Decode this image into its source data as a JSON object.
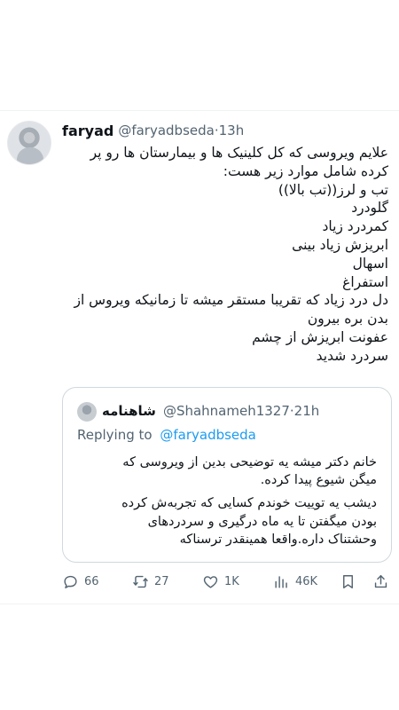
{
  "tweet": {
    "author": {
      "name": "faryad",
      "handle": "@faryadbseda",
      "time": "·13h"
    },
    "lines": [
      "علایم ویروسی که کل کلینیک ها و بیمارستان ها رو پر",
      "کرده شامل موارد زیر هست:",
      "تب و لرز((تب بالا))",
      "گلودرد",
      "کمردرد زیاد",
      "ابریزش زیاد بینی",
      "اسهال",
      "استفراغ",
      "دل درد زیاد که تقریبا مستقر میشه تا زمانیکه ویروس از",
      "بدن بره بیرون",
      "عفونت ابریزش از چشم",
      "سردرد شدید"
    ]
  },
  "quote": {
    "name": "شاهنامه",
    "handle": "@Shahnameh1327",
    "time": "·21h",
    "replying_prefix": "Replying to",
    "replying_handle": "@faryadbseda",
    "lines": [
      "خانم دکتر میشه یه توضیحی بدین از ویروسی که",
      "میگن شیوع پیدا کرده.",
      "دیشب یه توییت خوندم کسایی که تجربه‌ش کرده",
      "بودن میگفتن تا یه ماه درگیری و سردردهای",
      "وحشتناک داره.واقعا همینقدر ترسناکه"
    ]
  },
  "actions": {
    "replies": "66",
    "retweets": "27",
    "likes": "1K",
    "views": "46K",
    "icons": [
      "reply-icon",
      "retweet-icon",
      "like-icon",
      "views-icon",
      "bookmark-icon",
      "share-icon"
    ]
  },
  "colors": {
    "text": "#0f1419",
    "secondary": "#536471",
    "link": "#1d9bf0",
    "border": "#cfd9de"
  }
}
